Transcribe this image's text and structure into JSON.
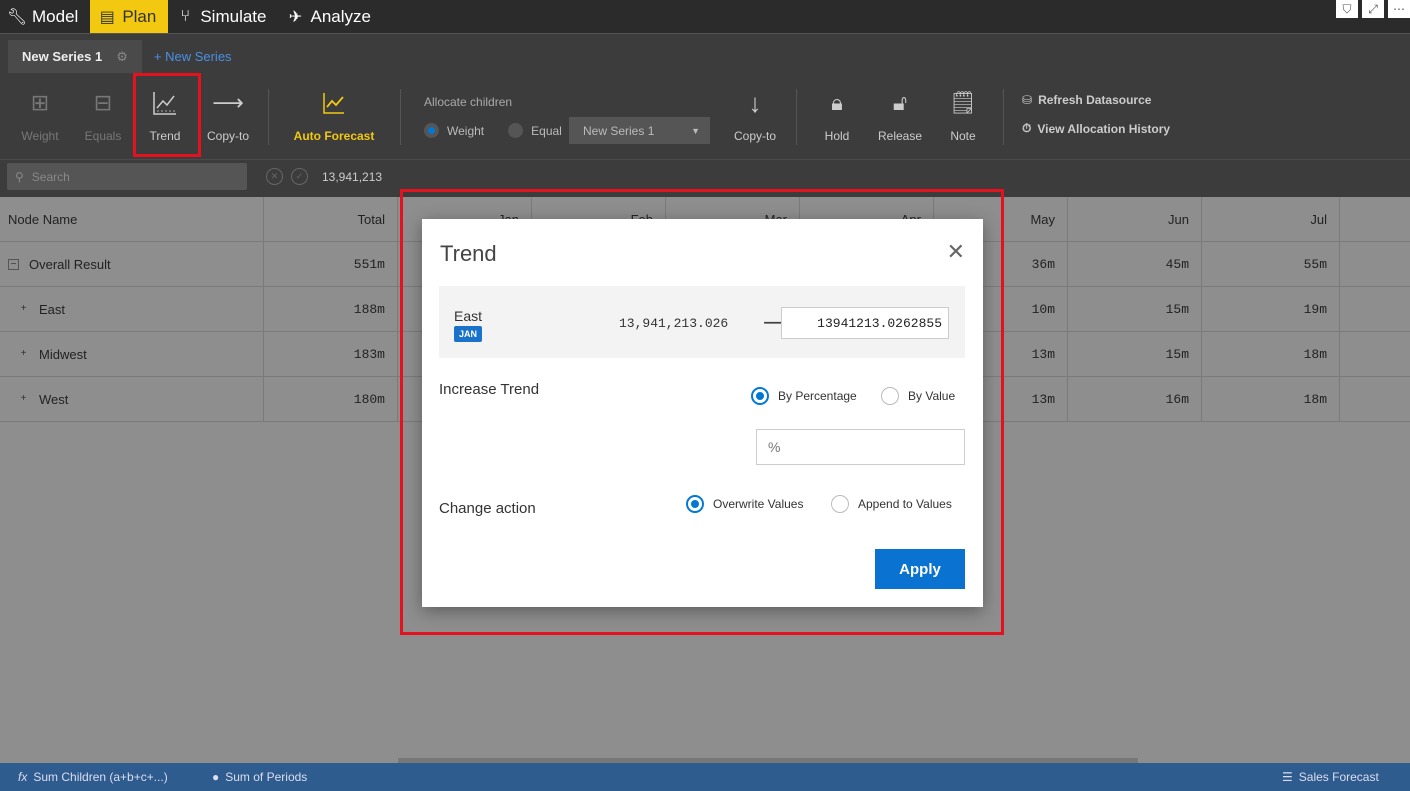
{
  "topnav": {
    "items": [
      {
        "label": "Model",
        "icon": "wrench-icon"
      },
      {
        "label": "Plan",
        "icon": "table-icon"
      },
      {
        "label": "Simulate",
        "icon": "branch-icon"
      },
      {
        "label": "Analyze",
        "icon": "telescope-icon"
      }
    ],
    "active": "Plan"
  },
  "series": {
    "current_tab": "New Series 1",
    "new_series_label": "+ New Series"
  },
  "toolbar": {
    "weight": "Weight",
    "equals": "Equals",
    "trend": "Trend",
    "copy_to": "Copy-to",
    "auto_forecast": "Auto Forecast",
    "allocate_children": "Allocate children",
    "alloc_weight": "Weight",
    "alloc_equal": "Equal",
    "series_select": "New Series 1",
    "copy_to_2": "Copy-to",
    "hold": "Hold",
    "release": "Release",
    "note": "Note",
    "refresh_datasource": "Refresh Datasource",
    "view_allocation_history": "View Allocation History"
  },
  "search": {
    "placeholder": "Search",
    "value": "13,941,213"
  },
  "grid": {
    "columns": [
      "Node Name",
      "Total",
      "Jan",
      "Feb",
      "Mar",
      "Apr",
      "May",
      "Jun",
      "Jul"
    ],
    "rows": [
      {
        "name": "Overall Result",
        "expander": "−",
        "total": "551m",
        "may": "36m",
        "jun": "45m",
        "jul": "55m"
      },
      {
        "name": "East",
        "expander": "+",
        "total": "188m",
        "may": "10m",
        "jun": "15m",
        "jul": "19m"
      },
      {
        "name": "Midwest",
        "expander": "+",
        "total": "183m",
        "may": "13m",
        "jun": "15m",
        "jul": "18m"
      },
      {
        "name": "West",
        "expander": "+",
        "total": "180m",
        "may": "13m",
        "jun": "16m",
        "jul": "18m"
      }
    ]
  },
  "statusbar": {
    "left1": "Sum Children (a+b+c+...)",
    "left2": "Sum of Periods",
    "right": "Sales Forecast"
  },
  "modal": {
    "title": "Trend",
    "member": "East",
    "period": "JAN",
    "original_value": "13,941,213.026",
    "new_value": "13941213.0262855",
    "increase_trend_label": "Increase Trend",
    "by_percentage": "By Percentage",
    "by_value": "By Value",
    "percent_placeholder": "%",
    "change_action_label": "Change action",
    "overwrite_values": "Overwrite Values",
    "append_to_values": "Append to Values",
    "apply": "Apply",
    "selected_trend_mode": "By Percentage",
    "selected_action": "Overwrite Values"
  },
  "colors": {
    "accent_yellow": "#f2c811",
    "primary_blue": "#0a72d1",
    "highlight_red": "#e3121e",
    "status_blue": "#2e5c8f"
  }
}
